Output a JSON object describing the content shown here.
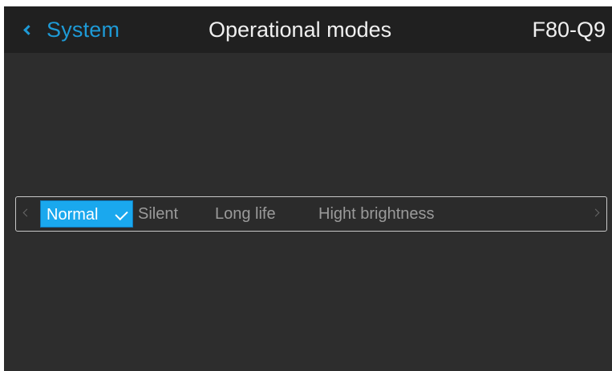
{
  "header": {
    "back_label": "System",
    "title": "Operational modes",
    "device": "F80-Q9"
  },
  "modes": {
    "selected": "Normal",
    "options": [
      "Normal",
      "Silent",
      "Long life",
      "Hight brightness"
    ]
  },
  "icons": {
    "back": "chevron-left-icon",
    "selected_mark": "check-icon",
    "scroll_left": "chevron-left-icon",
    "scroll_right": "chevron-right-icon"
  },
  "colors": {
    "accent": "#1aa8ee",
    "header_bg": "#202020",
    "screen_bg": "#2d2d2d",
    "inactive_text": "#9a9a9a"
  }
}
